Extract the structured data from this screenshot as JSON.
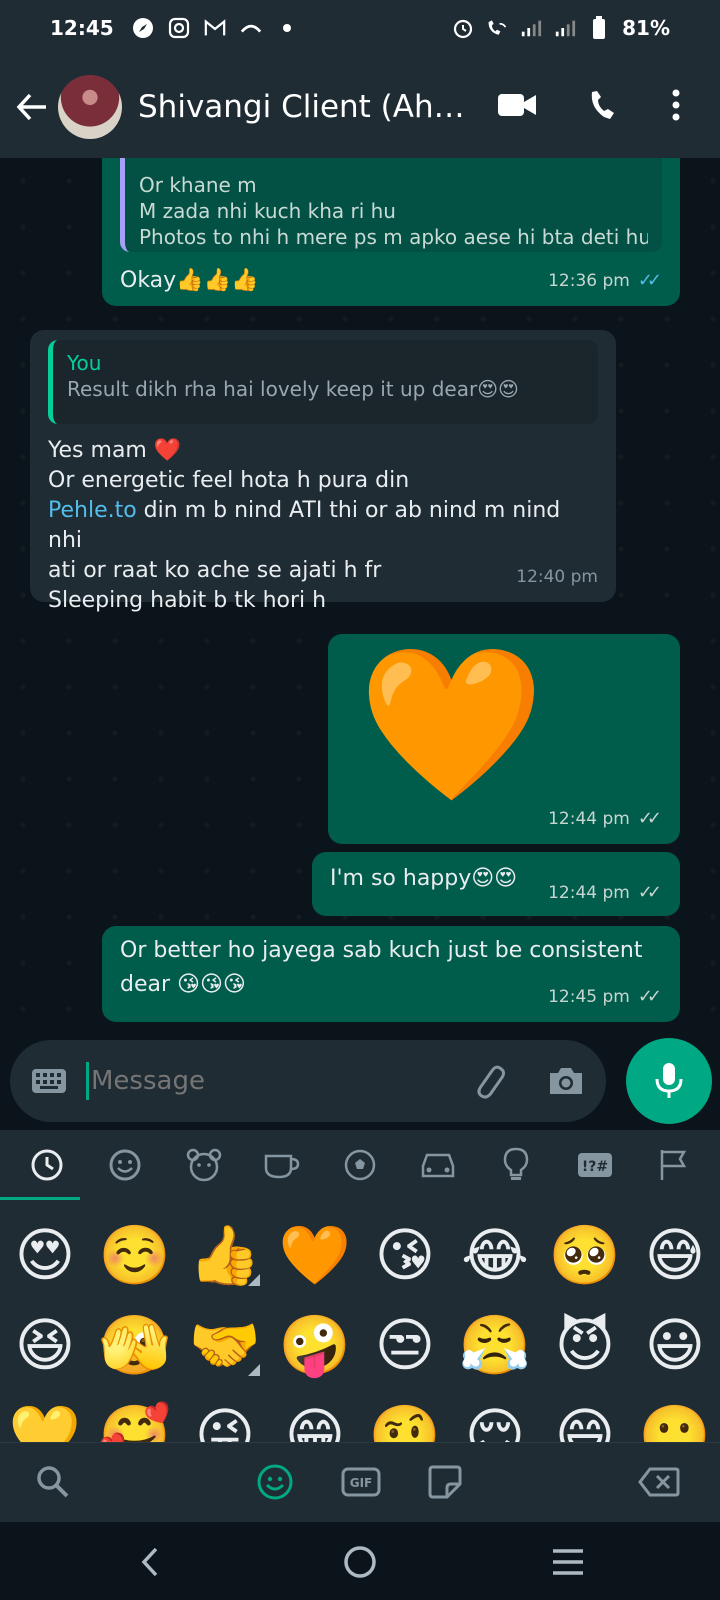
{
  "status_bar": {
    "time": "12:45",
    "battery": "81%"
  },
  "header": {
    "contact_name": "Shivangi Client (Ahar..."
  },
  "messages": [
    {
      "direction": "out",
      "quote_lines": [
        "Or khane m",
        "M zada nhi kuch kha ri hu",
        "Photos to nhi h mere ps m apko aese hi bta deti hu ..."
      ],
      "text": "Okay👍👍👍",
      "time": "12:36 pm",
      "status": "read"
    },
    {
      "direction": "in",
      "quote_author": "You",
      "quote_text": "Result dikh rha hai lovely keep it up dear😍😍",
      "lines": [
        "Yes mam ❤️",
        "Or energetic feel hota h pura din"
      ],
      "link_text": "Pehle.to",
      "link_after": " din m b nind ATI thi or ab nind m nind nhi",
      "lines_after": [
        "ati or raat ko ache se ajati h fr",
        "Sleeping habit b tk hori h"
      ],
      "time": "12:40 pm"
    },
    {
      "direction": "out",
      "sticker": "🧡",
      "time": "12:44 pm",
      "status": "delivered"
    },
    {
      "direction": "out",
      "text": "I'm so happy😍😍",
      "time": "12:44 pm",
      "status": "delivered"
    },
    {
      "direction": "out",
      "lines": [
        "Or better ho jayega sab kuch just be consistent",
        "dear 😘😘😘"
      ],
      "time": "12:45 pm",
      "status": "delivered"
    }
  ],
  "composer": {
    "placeholder": "Message"
  },
  "emoji_panel": {
    "categories": [
      "recent-icon",
      "smiley-icon",
      "animal-icon",
      "food-icon",
      "activity-icon",
      "travel-icon",
      "objects-icon",
      "symbols-icon",
      "flags-icon"
    ],
    "emojis": [
      "😍",
      "☺️",
      "👍",
      "🧡",
      "😘",
      "😂",
      "🥺",
      "😅",
      "😆",
      "🫣",
      "🤝",
      "🤪",
      "😒",
      "😤",
      "😈",
      "😃",
      "💛",
      "🥰",
      "😜",
      "😁",
      "🤨",
      "😌",
      "😄",
      "🙂"
    ]
  },
  "colors": {
    "outgoing_bubble": "#005c4b",
    "incoming_bubble": "#1f2c34",
    "accent": "#00a884",
    "read_ticks": "#53bdeb"
  }
}
